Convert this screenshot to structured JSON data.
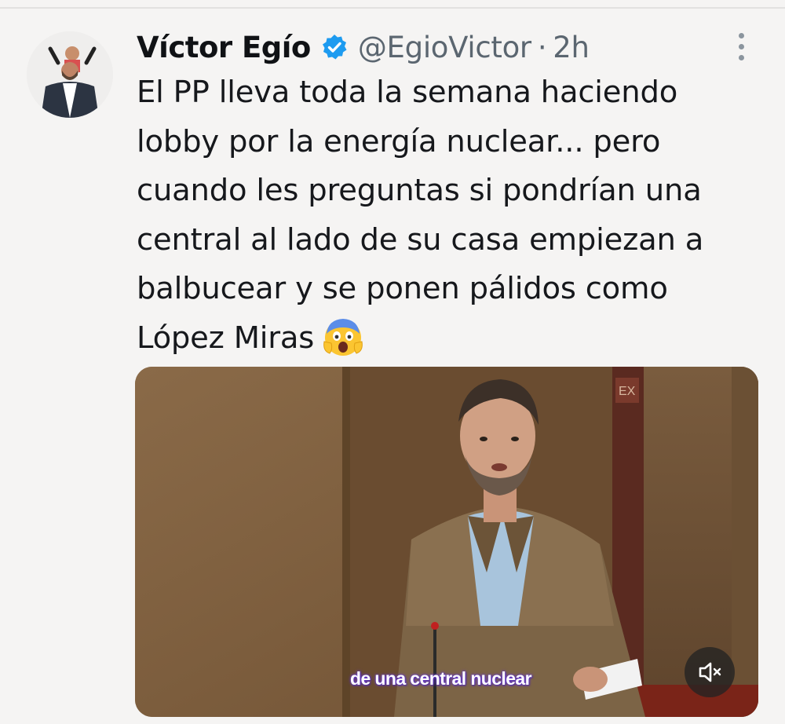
{
  "tweet": {
    "author": {
      "display_name": "Víctor Egío",
      "handle": "@EgioVictor",
      "verified_icon": "verified-badge-icon",
      "avatar": "avatar"
    },
    "separator": "·",
    "time": "2h",
    "more_icon": "more-vertical-icon",
    "text_lines": [
      "El PP lleva toda la semana haciendo",
      "lobby por la energía nuclear... pero",
      "cuando les preguntas si pondrían una",
      "central al lado de su casa empiezan a",
      "balbucear y se ponen pálidos como",
      "López Miras"
    ],
    "emoji": "screaming-face-emoji",
    "media": {
      "type": "video",
      "caption": "de una central nuclear",
      "mute_icon": "volume-muted-icon"
    }
  },
  "colors": {
    "background": "#f5f4f3",
    "text": "#16181c",
    "secondary_text": "#5b6670",
    "verified_blue": "#1d9bf0",
    "caption_glow": "#6a3cd8"
  }
}
